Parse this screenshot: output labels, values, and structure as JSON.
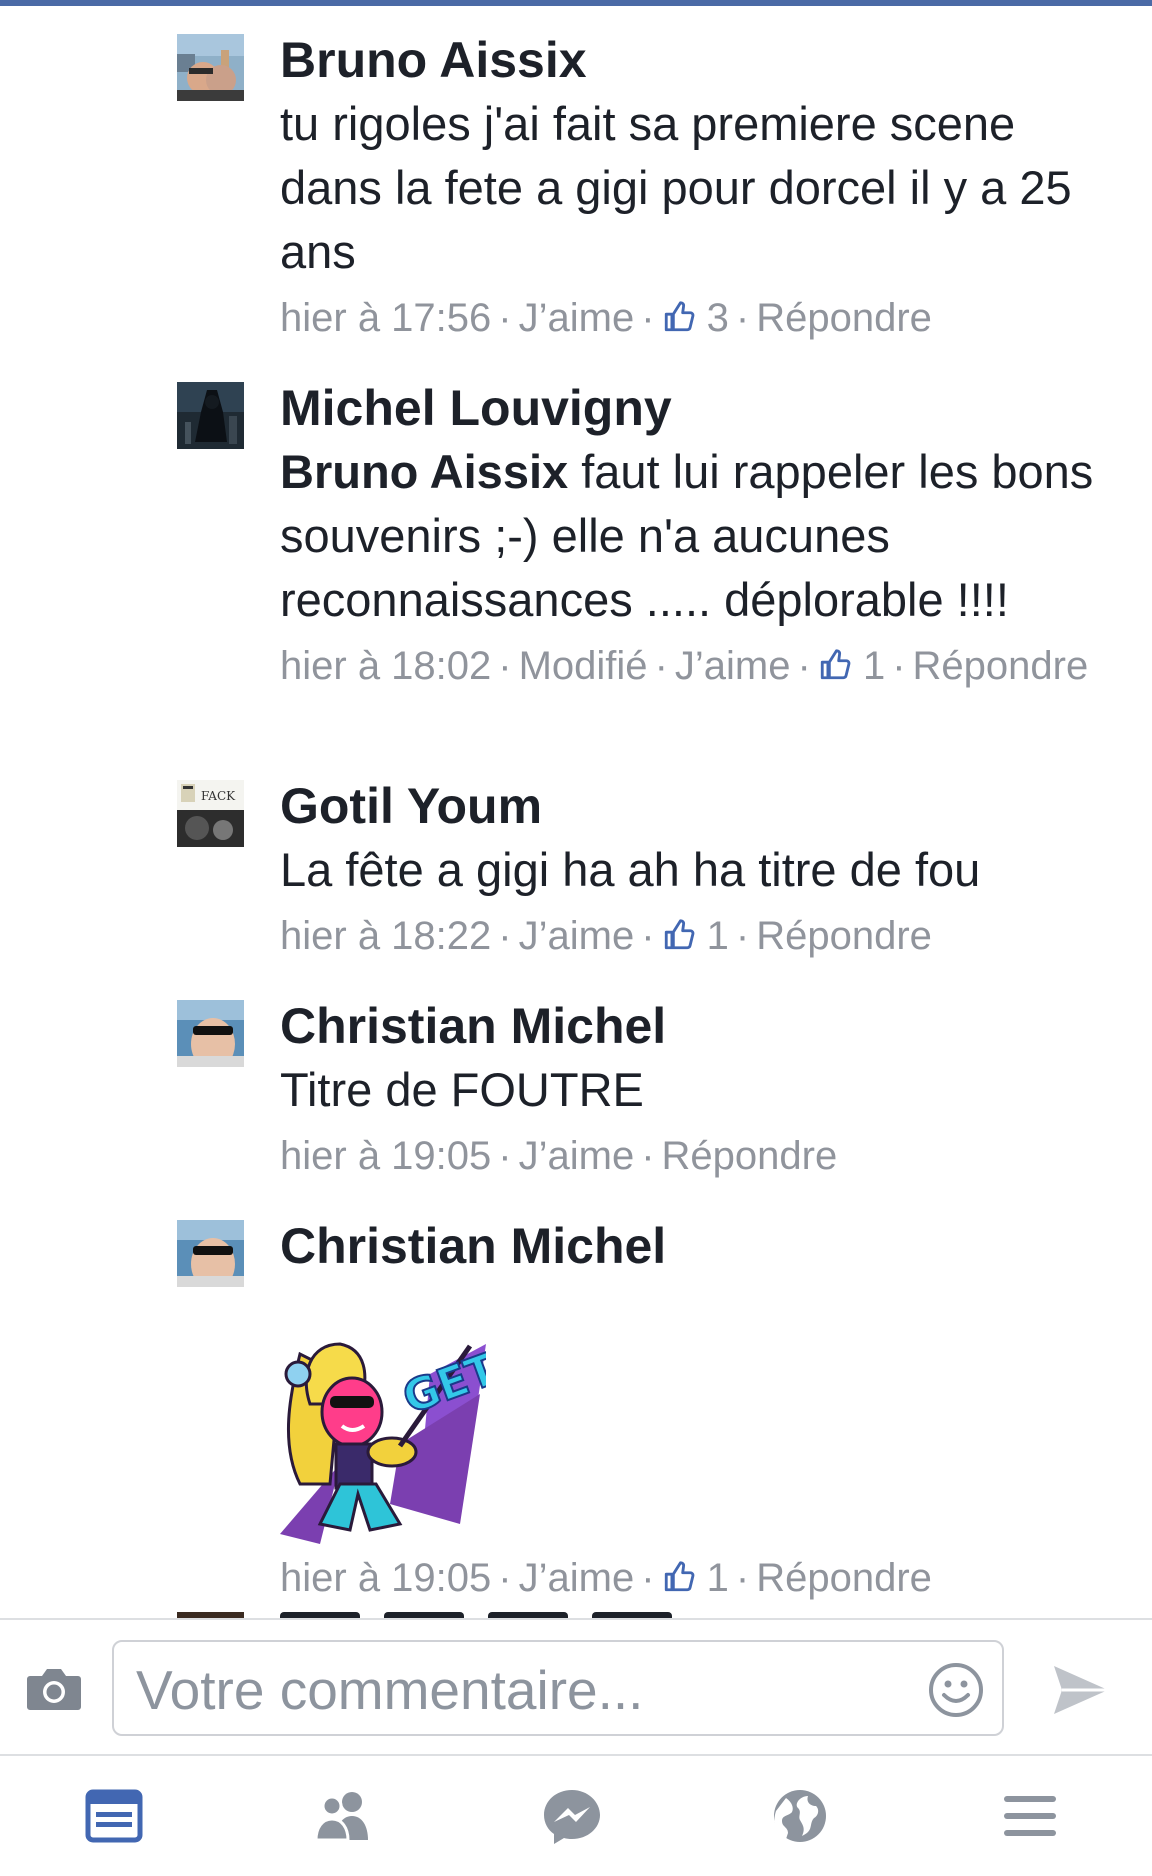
{
  "comments": [
    {
      "author": "Bruno Aissix",
      "text": "tu rigoles j'ai fait sa premiere scene dans la fete a gigi pour dorcel il y a 25 ans",
      "time": "hier à 17:56",
      "like": "J’aime",
      "likes": "3",
      "reply": "Répondre"
    },
    {
      "author": "Michel Louvigny",
      "mention": "Bruno Aissix",
      "text": " faut lui rappeler les bons souvenirs ;-) elle n'a aucunes reconnaissances ..... déplorable !!!!",
      "time": "hier à 18:02",
      "edited": "Modifié",
      "like": "J’aime",
      "likes": "1",
      "reply": "Répondre"
    },
    {
      "author": "Gotil Youm",
      "text": "La fête a gigi ha ah ha titre de fou",
      "time": "hier à 18:22",
      "like": "J’aime",
      "likes": "1",
      "reply": "Répondre"
    },
    {
      "author": "Christian Michel",
      "text": "Titre de FOUTRE",
      "time": "hier à 19:05",
      "like": "J’aime",
      "reply": "Répondre"
    },
    {
      "author": "Christian Michel",
      "sticker_text": "GET IT!",
      "time": "hier à 19:05",
      "like": "J’aime",
      "likes": "1",
      "reply": "Répondre"
    }
  ],
  "composer": {
    "placeholder": "Votre commentaire...",
    "camera_icon": "camera-icon",
    "emoji_icon": "smiley-icon",
    "send_icon": "send-icon"
  },
  "tabbar": {
    "items": [
      "news-feed-icon",
      "friends-icon",
      "messenger-icon",
      "globe-icon",
      "menu-icon"
    ],
    "active": "news-feed-icon"
  },
  "colors": {
    "accent": "#4267b2",
    "meta_text": "#90949c",
    "icon_grey": "#8d949e",
    "top_strip": "#4b6aa6"
  }
}
